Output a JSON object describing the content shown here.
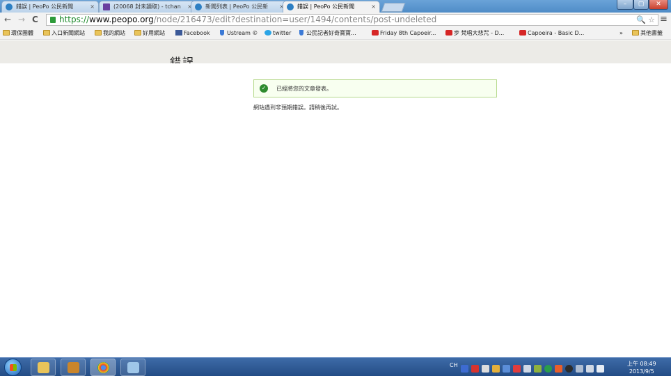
{
  "browser": {
    "tabs": [
      {
        "label": "錯誤 | PeoPo 公民新聞",
        "close": "×",
        "icon": "peopo-favicon-icon"
      },
      {
        "label": "(20068 封未讀取) - tchan",
        "close": "×",
        "icon": "mail-favicon-icon"
      },
      {
        "label": "新聞列表 | PeoPo 公民新",
        "close": "×",
        "icon": "peopo-favicon-icon"
      },
      {
        "label": "錯誤 | PeoPo 公民新聞",
        "close": "×",
        "icon": "peopo-favicon-icon"
      }
    ],
    "window_controls": {
      "minimize": "–",
      "maximize": "▢",
      "close": "✕"
    },
    "nav": {
      "back": "←",
      "forward": "→",
      "reload": "C"
    },
    "url": {
      "scheme": "https://",
      "host": "www.peopo.org",
      "path": "/node/216473/edit?destination=user/1494/contents/post-undeleted"
    },
    "omnibox_icons": "🔍 ☆",
    "menu": "≡",
    "bookmarks": [
      {
        "label": "環保團體",
        "icon": "folder-icon"
      },
      {
        "label": "入口新聞網站",
        "icon": "folder-icon"
      },
      {
        "label": "我的網站",
        "icon": "folder-icon"
      },
      {
        "label": "好用網站",
        "icon": "folder-icon"
      },
      {
        "label": "Facebook",
        "icon": "facebook-icon"
      },
      {
        "label": "Ustream ©",
        "icon": "ustream-icon"
      },
      {
        "label": "twitter",
        "icon": "twitter-icon"
      },
      {
        "label": "公民記者好奇寶寶...",
        "icon": "ustream-icon"
      },
      {
        "label": "Friday 8th Capoeir...",
        "icon": "youtube-icon"
      },
      {
        "label": "步 梵唱大悲咒 - D...",
        "icon": "youtube-icon"
      },
      {
        "label": "Capoeira - Basic D...",
        "icon": "youtube-icon"
      }
    ],
    "bookmarks_overflow": "»",
    "other_bookmarks": "其他書籤"
  },
  "page": {
    "title": "錯誤",
    "status_message": "已經將您的文章發表。",
    "error_message": "網站遇到非預期錯誤。請稍後再試。"
  },
  "taskbar": {
    "ime": "CH",
    "time": "上午 08:49",
    "date": "2013/9/5"
  }
}
